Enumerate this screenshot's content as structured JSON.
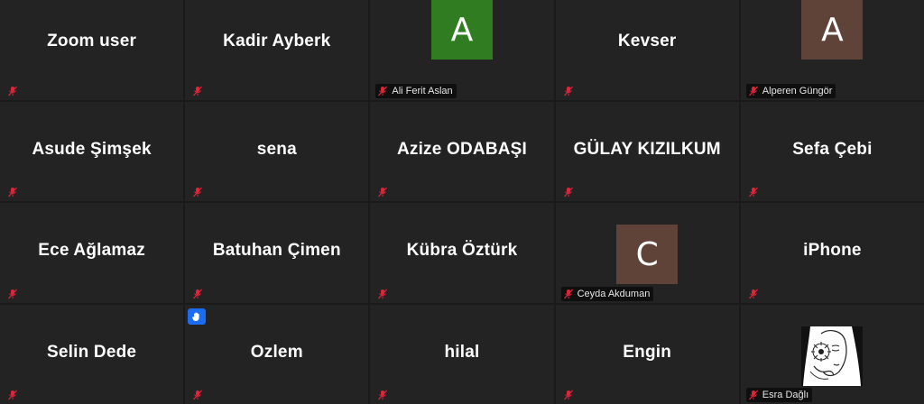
{
  "colors": {
    "tile_bg": "#232323",
    "grid_bg": "#1a1a1a",
    "muted_mic": "#e0243a",
    "raise_hand": "#1a6cf0"
  },
  "participants": [
    {
      "name": "Zoom user"
    },
    {
      "name": "Kadir Ayberk"
    },
    {
      "label": "Ali Ferit Aslan",
      "initial": "A",
      "avatar_color": "#2f7d20"
    },
    {
      "name": "Kevser"
    },
    {
      "label": "Alperen Güngör",
      "initial": "A",
      "avatar_color": "#5f4339"
    },
    {
      "name": "Asude Şimşek"
    },
    {
      "name": "sena"
    },
    {
      "name": "Azize ODABAŞI"
    },
    {
      "name": "GÜLAY KIZILKUM"
    },
    {
      "name": "Sefa Çebi"
    },
    {
      "name": "Ece Ağlamaz"
    },
    {
      "name": "Batuhan Çimen"
    },
    {
      "name": "Kübra Öztürk"
    },
    {
      "label": "Ceyda Akduman",
      "initial": "C",
      "avatar_color": "#5f4339"
    },
    {
      "name": "iPhone"
    },
    {
      "name": "Selin Dede"
    },
    {
      "name": "Ozlem",
      "hand_raised": true
    },
    {
      "name": "hilal"
    },
    {
      "name": "Engin"
    },
    {
      "label": "Esra Dağlı",
      "profile_photo": "sketch-portrait"
    }
  ]
}
